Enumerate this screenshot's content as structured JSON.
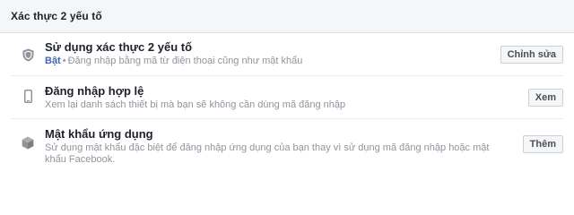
{
  "header": {
    "title": "Xác thực 2 yếu tố"
  },
  "rows": [
    {
      "icon": "shield-icon",
      "title": "Sử dụng xác thực 2 yếu tố",
      "status": "Bật",
      "separator": "•",
      "description": "Đăng nhập bằng mã từ điện thoại cũng như mật khẩu",
      "action_label": "Chỉnh sửa"
    },
    {
      "icon": "phone-icon",
      "title": "Đăng nhập hợp lệ",
      "description": "Xem lại danh sách thiết bị mà bạn sẽ không cần dùng mã đăng nhập",
      "action_label": "Xem"
    },
    {
      "icon": "cube-icon",
      "title": "Mật khẩu ứng dụng",
      "description": "Sử dụng mật khẩu đặc biệt để đăng nhập ứng dụng của bạn thay vì sử dụng mã đăng nhập hoặc mật khẩu Facebook.",
      "action_label": "Thêm"
    }
  ],
  "colors": {
    "header_bg": "#f5f6f7",
    "title_text": "#1d2129",
    "muted_text": "#90949c",
    "status_on": "#4267b2",
    "icon_gray": "#90949c",
    "button_bg": "#f5f6f7",
    "button_border": "#ccd0d5"
  }
}
